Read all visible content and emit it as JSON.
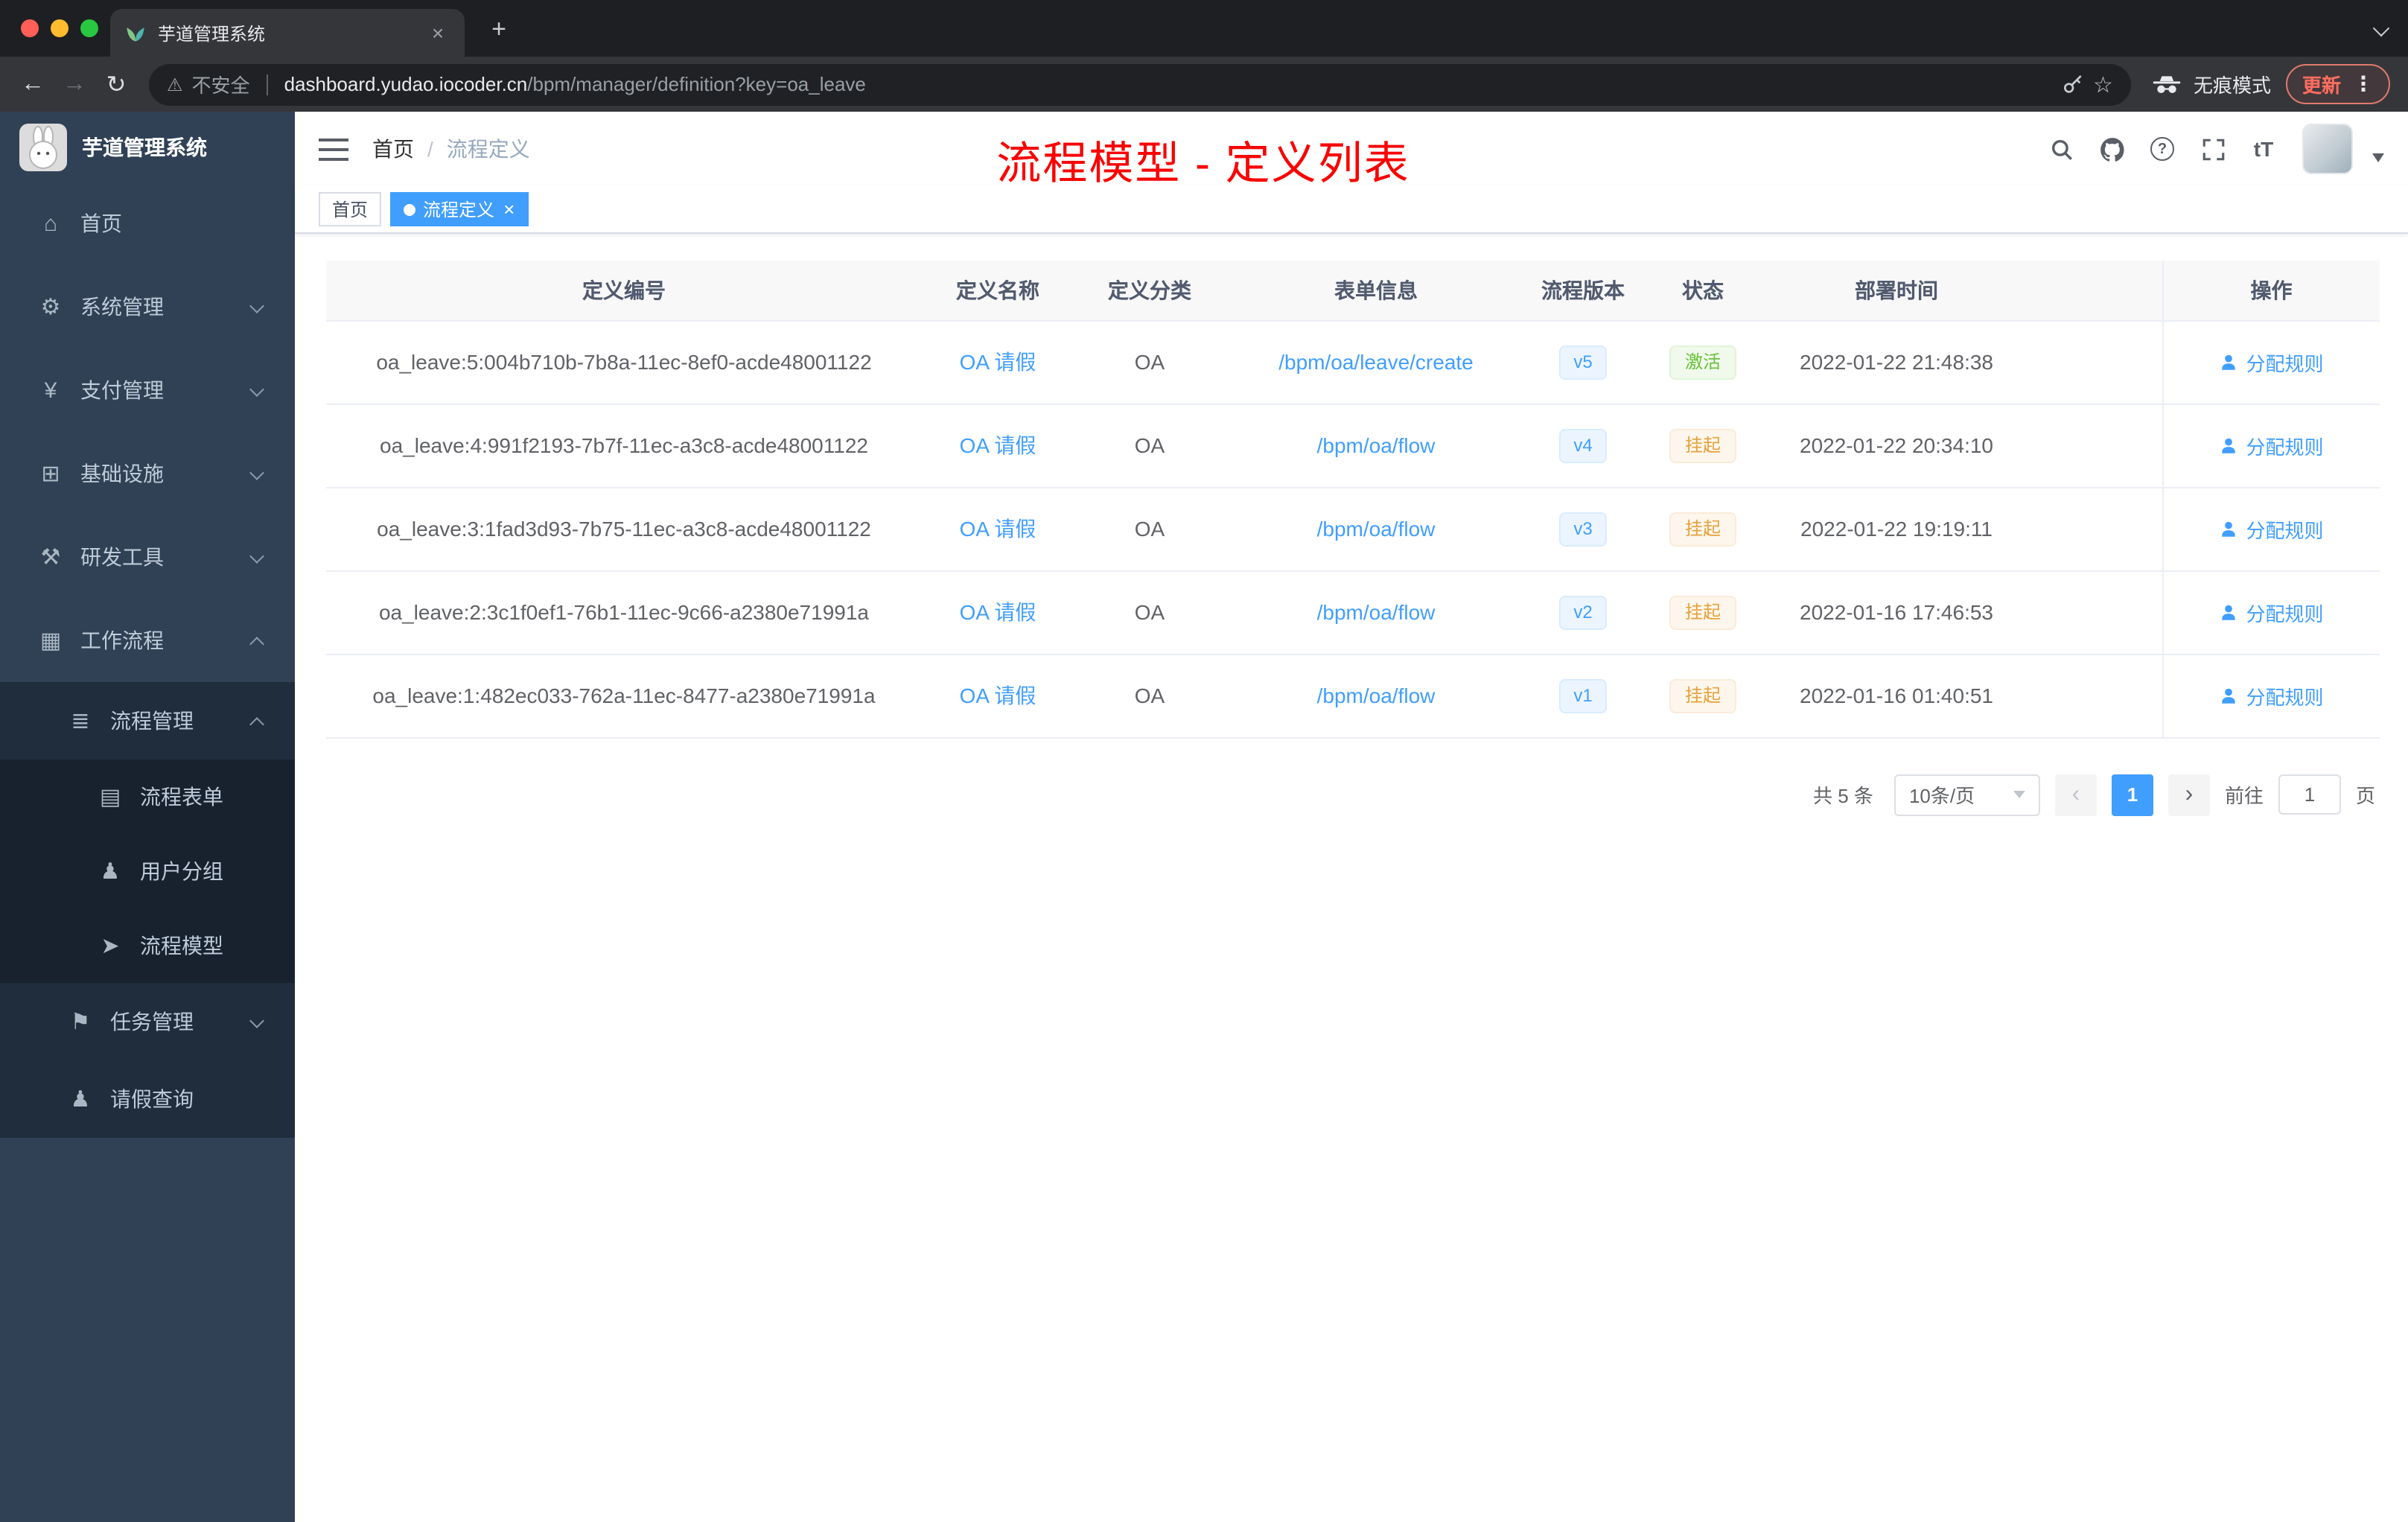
{
  "colors": {
    "accent": "#409eff",
    "success": "#67c23a",
    "warning": "#e6a23c",
    "annotation_red": "#fa0000",
    "sidebar_bg": "#304156",
    "submenu_bg": "#1f2d3d"
  },
  "glyphs": {
    "back": "←",
    "forward": "→",
    "reload": "↻",
    "warning": "⚠",
    "star": "☆",
    "dots": "⋮",
    "close": "×",
    "plus": "+",
    "help": "?",
    "font_size": "tT",
    "home": "⌂",
    "system": "⚙",
    "pay": "¥",
    "infra": "⊞",
    "devtools": "⚒",
    "workflow": "▦",
    "process_mgmt": "≣",
    "process_form": "▤",
    "user_group": "♟",
    "process_model": "➤",
    "task_mgmt": "⚑",
    "leave_query": "♟",
    "prev": "‹",
    "next": "›"
  },
  "browser": {
    "tab_title": "芋道管理系统",
    "security_label": "不安全",
    "url_host": "dashboard.yudao.iocoder.cn",
    "url_path": "/bpm/manager/definition?key=oa_leave",
    "incognito_label": "无痕模式",
    "update_label": "更新"
  },
  "sidebar": {
    "title": "芋道管理系统",
    "items": [
      {
        "label": "首页"
      },
      {
        "label": "系统管理"
      },
      {
        "label": "支付管理"
      },
      {
        "label": "基础设施"
      },
      {
        "label": "研发工具"
      },
      {
        "label": "工作流程"
      },
      {
        "label": "流程管理"
      },
      {
        "label": "流程表单"
      },
      {
        "label": "用户分组"
      },
      {
        "label": "流程模型"
      },
      {
        "label": "任务管理"
      },
      {
        "label": "请假查询"
      }
    ]
  },
  "header": {
    "breadcrumb_home": "首页",
    "breadcrumb_sep": "/",
    "breadcrumb_current": "流程定义",
    "annotation": "流程模型 - 定义列表"
  },
  "tags": {
    "home": "首页",
    "active": "流程定义"
  },
  "table": {
    "columns": [
      "定义编号",
      "定义名称",
      "定义分类",
      "表单信息",
      "流程版本",
      "状态",
      "部署时间",
      "操作"
    ],
    "rows": [
      {
        "id": "oa_leave:5:004b710b-7b8a-11ec-8ef0-acde48001122",
        "name": "OA 请假",
        "category": "OA",
        "form": "/bpm/oa/leave/create",
        "version": "v5",
        "status": "激活",
        "status_type": "success",
        "deploy_time": "2022-01-22 21:48:38",
        "action": "分配规则"
      },
      {
        "id": "oa_leave:4:991f2193-7b7f-11ec-a3c8-acde48001122",
        "name": "OA 请假",
        "category": "OA",
        "form": "/bpm/oa/flow",
        "version": "v4",
        "status": "挂起",
        "status_type": "warning",
        "deploy_time": "2022-01-22 20:34:10",
        "action": "分配规则"
      },
      {
        "id": "oa_leave:3:1fad3d93-7b75-11ec-a3c8-acde48001122",
        "name": "OA 请假",
        "category": "OA",
        "form": "/bpm/oa/flow",
        "version": "v3",
        "status": "挂起",
        "status_type": "warning",
        "deploy_time": "2022-01-22 19:19:11",
        "action": "分配规则"
      },
      {
        "id": "oa_leave:2:3c1f0ef1-76b1-11ec-9c66-a2380e71991a",
        "name": "OA 请假",
        "category": "OA",
        "form": "/bpm/oa/flow",
        "version": "v2",
        "status": "挂起",
        "status_type": "warning",
        "deploy_time": "2022-01-16 17:46:53",
        "action": "分配规则"
      },
      {
        "id": "oa_leave:1:482ec033-762a-11ec-8477-a2380e71991a",
        "name": "OA 请假",
        "category": "OA",
        "form": "/bpm/oa/flow",
        "version": "v1",
        "status": "挂起",
        "status_type": "warning",
        "deploy_time": "2022-01-16 01:40:51",
        "action": "分配规则"
      }
    ]
  },
  "pagination": {
    "total": "共 5 条",
    "page_size": "10条/页",
    "current": "1",
    "goto": "前往",
    "goto_value": "1",
    "unit": "页"
  }
}
